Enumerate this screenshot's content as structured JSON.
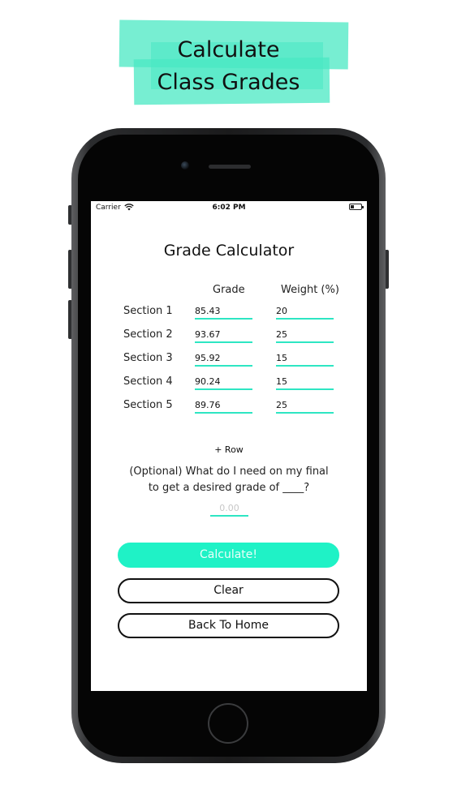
{
  "banner": {
    "line1": "Calculate",
    "line2": "Class Grades"
  },
  "status_bar": {
    "carrier": "Carrier",
    "time": "6:02 PM"
  },
  "screen": {
    "title": "Grade Calculator",
    "columns": {
      "grade": "Grade",
      "weight": "Weight (%)"
    },
    "rows": [
      {
        "label": "Section 1",
        "grade": "85.43",
        "weight": "20"
      },
      {
        "label": "Section 2",
        "grade": "93.67",
        "weight": "25"
      },
      {
        "label": "Section 3",
        "grade": "95.92",
        "weight": "15"
      },
      {
        "label": "Section 4",
        "grade": "90.24",
        "weight": "15"
      },
      {
        "label": "Section 5",
        "grade": "89.76",
        "weight": "25"
      }
    ],
    "add_row_label": "+ Row",
    "optional_line1": "(Optional) What do I need on my final",
    "optional_line2": "to get a desired grade of ____?",
    "desired_placeholder": "0.00",
    "buttons": {
      "calculate": "Calculate!",
      "clear": "Clear",
      "back": "Back To Home"
    }
  },
  "colors": {
    "accent": "#1ff2c6",
    "banner_highlight": "#49e8c3"
  }
}
